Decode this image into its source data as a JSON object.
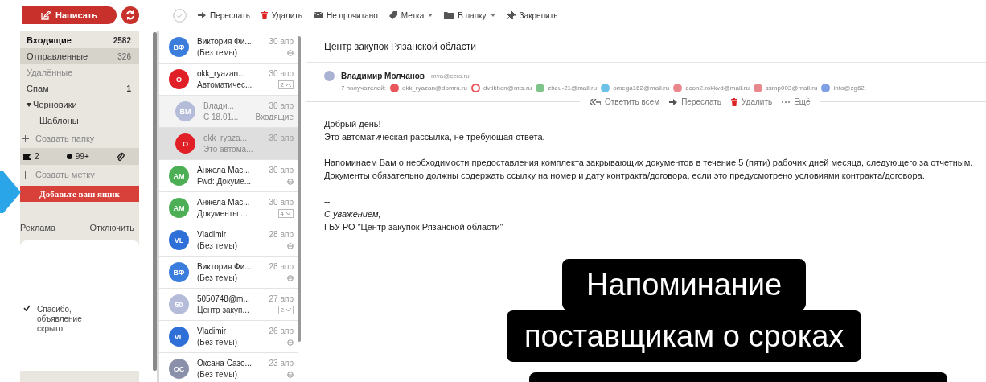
{
  "compose": {
    "label": "Написать"
  },
  "folders": [
    {
      "name": "Входящие",
      "count": "2582",
      "selected": false,
      "unread": true
    },
    {
      "name": "Отправленные",
      "count": "326",
      "selected": true,
      "unread": false
    },
    {
      "name": "Удалённые",
      "selected": false,
      "unread": false
    },
    {
      "name": "Спам",
      "count": "1",
      "selected": false,
      "unread": false
    },
    {
      "name": "Черновики",
      "selected": false,
      "unread": false,
      "expanded": true,
      "children": [
        {
          "name": "Шаблоны",
          "selected": false,
          "unread": false
        }
      ]
    }
  ],
  "create_folder": "Создать папку",
  "label_filters": [
    {
      "kind": "flag",
      "count": "2"
    },
    {
      "kind": "dot",
      "count": "99+"
    },
    {
      "kind": "attachment"
    }
  ],
  "create_label": "Создать метку",
  "add_mailbox": "Добавьте ваш ящик",
  "ad": {
    "title": "Реклама",
    "action": "Отключить",
    "notice": "Спасибо, объявление скрыто."
  },
  "toolbar": [
    {
      "kind": "forward",
      "label": "Переслать",
      "dropdown": false
    },
    {
      "kind": "delete",
      "label": "Удалить",
      "dropdown": false
    },
    {
      "kind": "unread",
      "label": "Не прочитано",
      "dropdown": false
    },
    {
      "kind": "label",
      "label": "Метка",
      "dropdown": true
    },
    {
      "kind": "folder",
      "label": "В папку",
      "dropdown": true
    },
    {
      "kind": "pin",
      "label": "Закрепить",
      "dropdown": false
    }
  ],
  "messages": [
    {
      "initials": "ВФ",
      "color": "#3b7ddd",
      "sender": "Виктория Фи...",
      "subject": "(Без темы)",
      "date": "30 апр",
      "kind": "status",
      "selected": false
    },
    {
      "initials": "O",
      "color": "#e01f26",
      "sender": "okk_ryazan...",
      "subject": "Автоматичес...",
      "date": "30 апр",
      "kind": "thread",
      "count": "2",
      "expanded": true,
      "selected": false,
      "children": [
        {
          "initials": "ВМ",
          "color": "#b5bcd9",
          "sender": "Влади...",
          "subject": "С 18.01...",
          "date": "30 апр",
          "kind": "folder",
          "folder": "Входящие",
          "selected": false
        },
        {
          "initials": "O",
          "color": "#e01f26",
          "sender": "okk_ryaza...",
          "subject": "Это автома...",
          "date": "30 апр",
          "kind": "none",
          "selected": true
        }
      ]
    },
    {
      "initials": "АМ",
      "color": "#4cae55",
      "sender": "Анжела Мас...",
      "subject": "Fwd: Докуме...",
      "date": "30 апр",
      "kind": "status",
      "selected": false
    },
    {
      "initials": "АМ",
      "color": "#4cae55",
      "sender": "Анжела Мас...",
      "subject": "Документы ...",
      "date": "30 апр",
      "kind": "thread",
      "count": "4",
      "expanded": false,
      "selected": false
    },
    {
      "initials": "VL",
      "color": "#2e6fd8",
      "sender": "Vladimir",
      "subject": "(Без темы)",
      "date": "28 апр",
      "kind": "status",
      "selected": false
    },
    {
      "initials": "ВФ",
      "color": "#3b7ddd",
      "sender": "Виктория Фи...",
      "subject": "(Без темы)",
      "date": "28 апр",
      "kind": "status",
      "selected": false
    },
    {
      "initials": "50",
      "color": "#b5bcd9",
      "sender": "5050748@m...",
      "subject": "Центр закуп...",
      "date": "27 апр",
      "kind": "thread",
      "count": "2",
      "expanded": false,
      "selected": false
    },
    {
      "initials": "VL",
      "color": "#2e6fd8",
      "sender": "Vladimir",
      "subject": "(Без темы)",
      "date": "26 апр",
      "kind": "status",
      "selected": false
    },
    {
      "initials": "ОС",
      "color": "#8a90aa",
      "sender": "Оксана Сазо...",
      "subject": "(Без темы)",
      "date": "23 апр",
      "kind": "status",
      "selected": false
    }
  ],
  "message": {
    "subject": "Центр закупок Рязанской области",
    "sender": {
      "color": "#aab2d4",
      "name": "Владимир Молчанов",
      "email": "mva@czro.ru"
    },
    "recipients_label": "7 получателей:",
    "recipients": [
      {
        "kind": "dot",
        "color": "#e8555b",
        "email": "okk_ryazan@domru.ru"
      },
      {
        "kind": "ring",
        "color": "#e8555b",
        "email": "dvtikhon@mts.ru"
      },
      {
        "kind": "dot",
        "color": "#7fc48a",
        "email": "zheu-21@mail.ru"
      },
      {
        "kind": "dot",
        "color": "#6ec0e6",
        "email": "omega162@mail.ru"
      },
      {
        "kind": "dot",
        "color": "#e8888c",
        "email": "econ2.rokkvd@mail.ru"
      },
      {
        "kind": "dot",
        "color": "#e8888c",
        "email": "ssmp003@mail.ru"
      },
      {
        "kind": "dot",
        "color": "#7f9fe6",
        "email": "info@zg62."
      }
    ],
    "actions": [
      {
        "kind": "reply_all",
        "label": "Ответить всем"
      },
      {
        "kind": "forward",
        "label": "Переслать"
      },
      {
        "kind": "delete",
        "label": "Удалить"
      },
      {
        "kind": "more",
        "label": "Ещё"
      }
    ],
    "paragraphs": [
      [
        "Добрый день!",
        "Это автоматическая рассылка, не требующая ответа."
      ],
      [
        "Напоминаем Вам о необходимости предоставления комплекта закрывающих документов в течение 5 (пяти) рабочих дней месяца, следующего за отчетным.",
        "Документы обязательно должны содержать ссылку на номер и дату контракта/договора, если это предусмотрено условиями контракта/договора."
      ]
    ],
    "signature": {
      "separator": "--",
      "closing": "С уважением,",
      "organization": "ГБУ РО \"Центр закупок Рязанской области\""
    }
  },
  "caption": {
    "lines": [
      "Напоминание",
      "поставщикам о сроках"
    ]
  }
}
